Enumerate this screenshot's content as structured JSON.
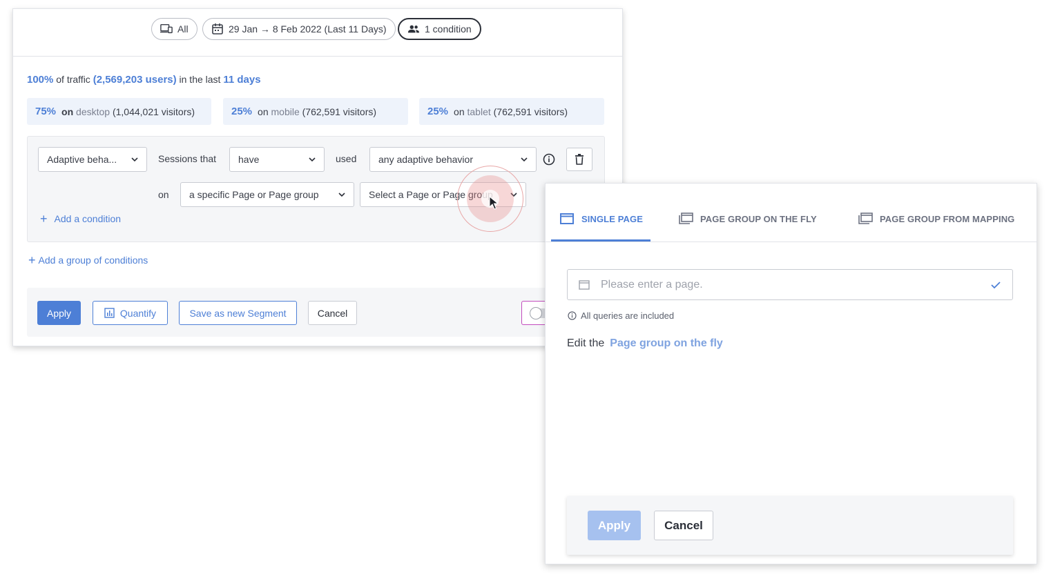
{
  "filters": {
    "device": "All",
    "date_range": "29 Jan → 8 Feb 2022 (Last 11 Days)",
    "conditions": "1 condition"
  },
  "traffic": {
    "pct": "100%",
    "of_traffic": "of traffic",
    "users": "(2,569,203 users)",
    "in_the_last": "in the last",
    "days": "11 days"
  },
  "stats": [
    {
      "pct": "75%",
      "on": "on",
      "device": "desktop",
      "visitors": "(1,044,021 visitors)"
    },
    {
      "pct": "25%",
      "on": "on",
      "device": "mobile",
      "visitors": "(762,591 visitors)"
    },
    {
      "pct": "25%",
      "on": "on",
      "device": "tablet",
      "visitors": "(762,591 visitors)"
    }
  ],
  "condition": {
    "type": "Adaptive beha...",
    "sessions_that": "Sessions that",
    "verb": "have",
    "used": "used",
    "behavior": "any adaptive behavior",
    "on": "on",
    "page_scope": "a specific Page or Page group",
    "page_select": "Select a Page or Page group",
    "add_condition": "Add a condition",
    "add_group": "Add a group of conditions"
  },
  "actions": {
    "apply": "Apply",
    "quantify": "Quantify",
    "save_segment": "Save as new Segment",
    "cancel": "Cancel"
  },
  "side_panel": {
    "tabs": [
      "SINGLE PAGE",
      "PAGE GROUP ON THE FLY",
      "PAGE GROUP FROM MAPPING"
    ],
    "active_tab": "SINGLE PAGE",
    "input_placeholder": "Please enter a page.",
    "note": "All queries are included",
    "edit_prefix": "Edit the",
    "edit_link": "Page group on the fly",
    "apply": "Apply",
    "cancel": "Cancel"
  },
  "colors": {
    "accent": "#4d7fd6",
    "panel_bg": "#f5f6f8",
    "stat_bg": "#eef3fb",
    "disabled_button": "#a6c1ef",
    "toggle_border": "#c24bbd"
  }
}
